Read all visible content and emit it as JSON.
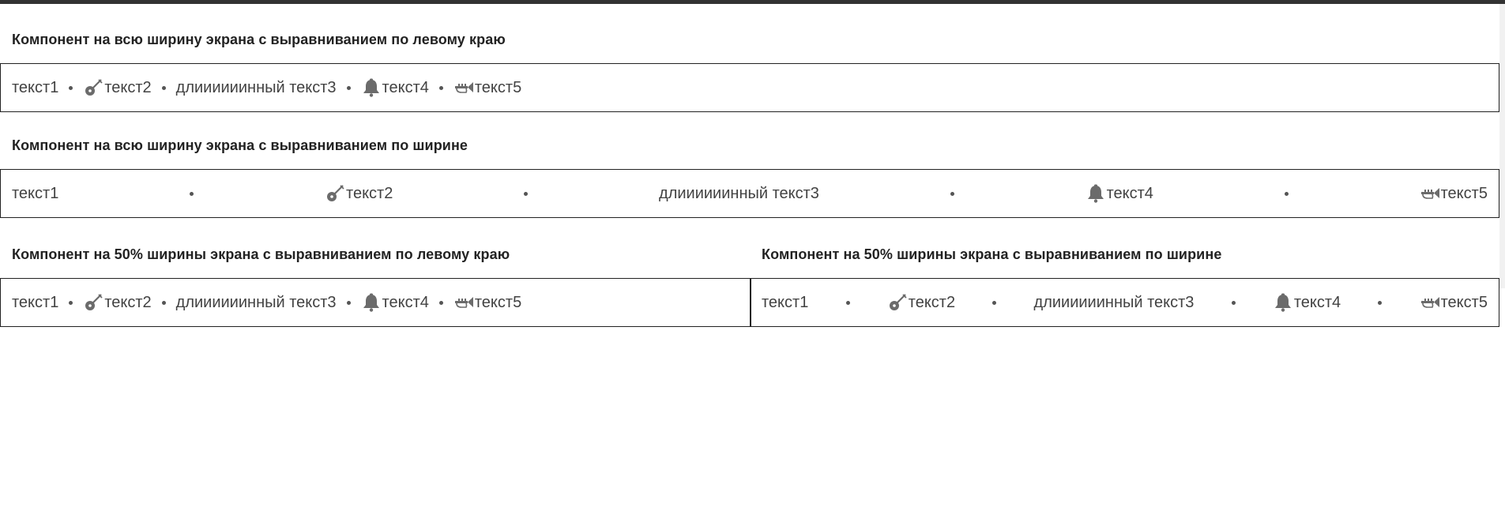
{
  "sections": [
    {
      "title": "Компонент на всю ширину экрана с выравниванием по левому краю",
      "items": [
        {
          "label": "текст1",
          "icon": ""
        },
        {
          "label": "текст2",
          "icon": "guitar-icon"
        },
        {
          "label": "длиииииинный текст3",
          "icon": ""
        },
        {
          "label": "текст4",
          "icon": "bell-icon"
        },
        {
          "label": "текст5",
          "icon": "trumpet-icon"
        }
      ]
    },
    {
      "title": "Компонент на всю ширину экрана с выравниванием по ширине",
      "items": [
        {
          "label": "текст1",
          "icon": ""
        },
        {
          "label": "текст2",
          "icon": "guitar-icon"
        },
        {
          "label": "длиииииинный текст3",
          "icon": ""
        },
        {
          "label": "текст4",
          "icon": "bell-icon"
        },
        {
          "label": "текст5",
          "icon": "trumpet-icon"
        }
      ]
    },
    {
      "title": "Компонент на 50% ширины экрана с выравниванием по левому краю",
      "items": [
        {
          "label": "текст1",
          "icon": ""
        },
        {
          "label": "текст2",
          "icon": "guitar-icon"
        },
        {
          "label": "длиииииинный текст3",
          "icon": ""
        },
        {
          "label": "текст4",
          "icon": "bell-icon"
        },
        {
          "label": "текст5",
          "icon": "trumpet-icon"
        }
      ]
    },
    {
      "title": "Компонент на 50% ширины экрана с выравниванием по ширине",
      "items": [
        {
          "label": "текст1",
          "icon": ""
        },
        {
          "label": "текст2",
          "icon": "guitar-icon"
        },
        {
          "label": "длиииииинный текст3",
          "icon": ""
        },
        {
          "label": "текст4",
          "icon": "bell-icon"
        },
        {
          "label": "текст5",
          "icon": "trumpet-icon"
        }
      ]
    }
  ],
  "colors": {
    "text": "#424242",
    "icon": "#6b6b6b",
    "border": "#222222",
    "title": "#222222"
  }
}
